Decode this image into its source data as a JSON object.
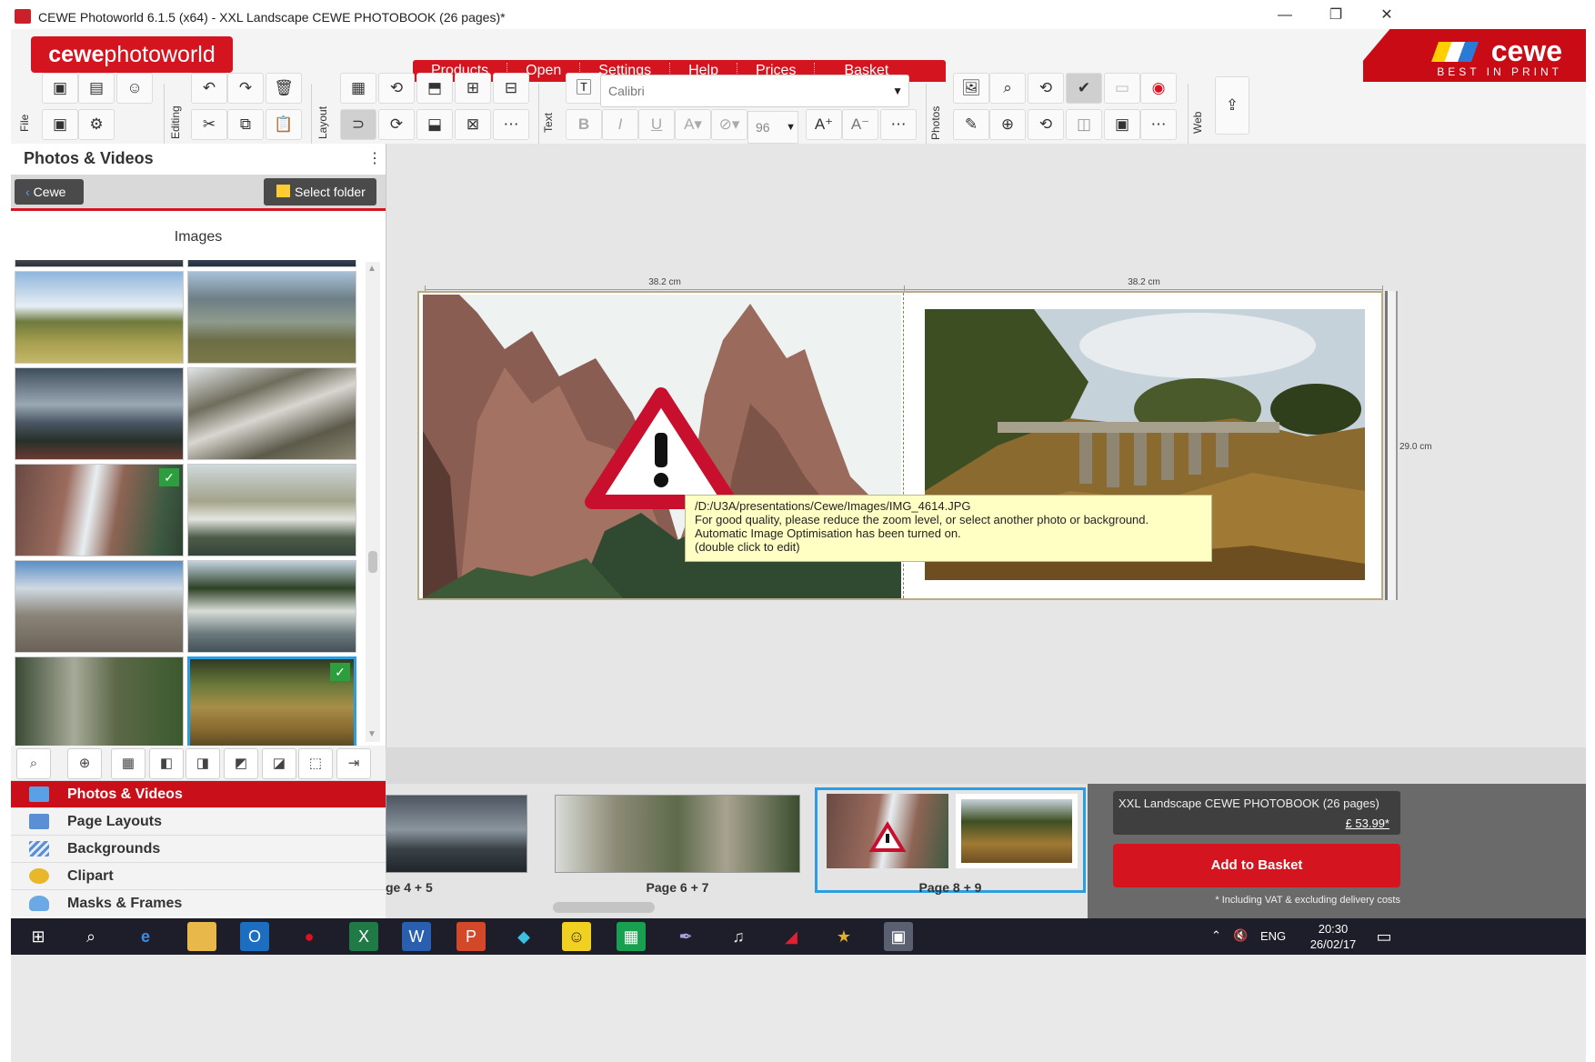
{
  "window": {
    "title": "CEWE Photoworld 6.1.5 (x64) - XXL Landscape CEWE PHOTOBOOK (26 pages)*",
    "minimize": "—",
    "restore": "❐",
    "close": "✕"
  },
  "brand": {
    "logo_bold": "cewe",
    "logo_light": "photoworld",
    "name": "cewe",
    "tagline": "BEST IN PRINT"
  },
  "menu": [
    "Products",
    "Open",
    "Settings",
    "Help",
    "Prices",
    "Basket"
  ],
  "toolbar": {
    "groups": [
      "File",
      "Editing",
      "Layout",
      "Text",
      "Photos",
      "Web"
    ],
    "font_name": "Calibri",
    "font_size": "96",
    "bold": "B",
    "italic": "I",
    "underline": "U"
  },
  "left_panel": {
    "title": "Photos & Videos",
    "back_label": "Cewe",
    "select_folder_label": "Select folder",
    "images_label": "Images"
  },
  "categories": [
    {
      "label": "Photos & Videos",
      "active": true,
      "icon": "photos-icon"
    },
    {
      "label": "Page Layouts",
      "active": false,
      "icon": "layouts-icon"
    },
    {
      "label": "Backgrounds",
      "active": false,
      "icon": "backgrounds-icon"
    },
    {
      "label": "Clipart",
      "active": false,
      "icon": "clipart-icon"
    },
    {
      "label": "Masks & Frames",
      "active": false,
      "icon": "masks-icon"
    }
  ],
  "canvas": {
    "width_left": "38.2 cm",
    "width_right": "38.2 cm",
    "height_right": "29.0 cm",
    "tooltip": [
      "/D:/U3A/presentations/Cewe/Images/IMG_4614.JPG",
      "For good quality, please reduce the zoom level, or select another photo or background.",
      "Automatic Image Optimisation has been turned on.",
      "(double click to edit)"
    ]
  },
  "pages": [
    "ge 4 + 5",
    "Page 6 + 7",
    "Page 8 + 9"
  ],
  "basket": {
    "product": "XXL Landscape CEWE PHOTOBOOK (26 pages)",
    "price": "£ 53.99*",
    "button": "Add to Basket",
    "note": "* Including VAT & excluding delivery costs"
  },
  "taskbar": {
    "language": "ENG",
    "time": "20:30",
    "date": "26/02/17"
  },
  "colors": {
    "brand_red": "#d4141f",
    "selection_blue": "#2a9ee0",
    "tooltip_yellow": "#ffffc4"
  }
}
